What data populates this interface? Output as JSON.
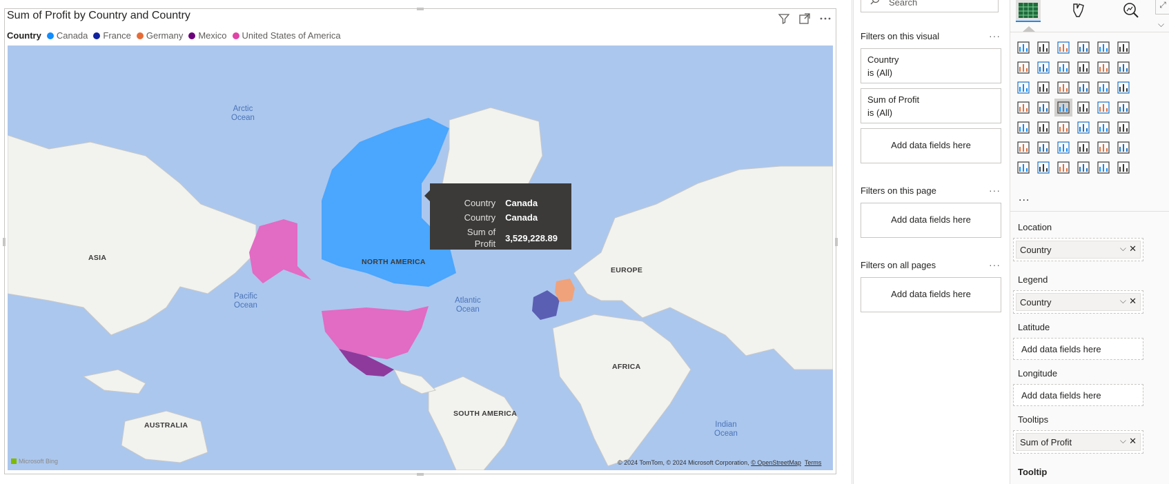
{
  "visual": {
    "title": "Sum of Profit by Country and Country",
    "legend": {
      "title": "Country",
      "items": [
        {
          "label": "Canada",
          "color": "#118dff"
        },
        {
          "label": "France",
          "color": "#12239e"
        },
        {
          "label": "Germany",
          "color": "#e66c37"
        },
        {
          "label": "Mexico",
          "color": "#6b007b"
        },
        {
          "label": "United States of America",
          "color": "#e044a7"
        }
      ]
    },
    "icons": [
      "filter-icon",
      "focus-mode-icon",
      "more-options-icon"
    ],
    "map": {
      "oceans": [
        {
          "text": "Arctic\nOcean"
        },
        {
          "text": "Pacific\nOcean"
        },
        {
          "text": "Atlantic\nOcean"
        },
        {
          "text": "Indian\nOcean"
        }
      ],
      "continents": [
        "ASIA",
        "NORTH AMERICA",
        "EUROPE",
        "AFRICA",
        "SOUTH AMERICA",
        "AUSTRALIA"
      ],
      "bing": "Microsoft Bing",
      "attribution": "© 2024 TomTom, © 2024 Microsoft Corporation,",
      "attribution_osm": "© OpenStreetMap",
      "attribution_terms": "Terms"
    },
    "tooltip": [
      {
        "key": "Country",
        "value": "Canada"
      },
      {
        "key": "Country",
        "value": "Canada"
      },
      {
        "key": "Sum of Profit",
        "value": "3,529,228.89"
      }
    ]
  },
  "filters": {
    "search_placeholder": "Search",
    "visual_header": "Filters on this visual",
    "visual_cards": [
      {
        "field": "Country",
        "state": "is (All)"
      },
      {
        "field": "Sum of Profit",
        "state": "is (All)"
      }
    ],
    "add_label": "Add data fields here",
    "page_header": "Filters on this page",
    "all_header": "Filters on all pages",
    "more": "···"
  },
  "viz": {
    "more": "...",
    "wells": {
      "location": {
        "label": "Location",
        "field": "Country"
      },
      "legend": {
        "label": "Legend",
        "field": "Country"
      },
      "latitude": {
        "label": "Latitude",
        "placeholder": "Add data fields here"
      },
      "longitude": {
        "label": "Longitude",
        "placeholder": "Add data fields here"
      },
      "tooltips": {
        "label": "Tooltips",
        "field": "Sum of Profit"
      },
      "tooltip": {
        "label": "Tooltip"
      }
    }
  }
}
